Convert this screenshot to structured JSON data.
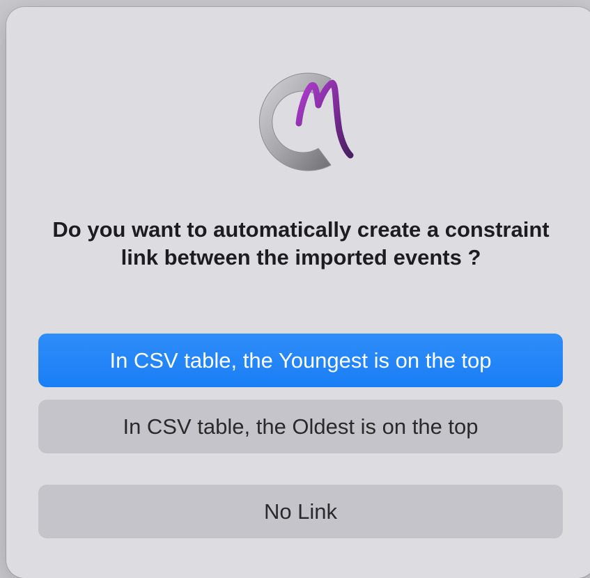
{
  "dialog": {
    "app_icon": "chronomodel-cm-logo-icon",
    "message": "Do you want to automatically create a constraint link between the imported events ?",
    "buttons": {
      "youngest_top": "In CSV table, the Youngest is on the top",
      "oldest_top": "In CSV table, the Oldest is on the top",
      "no_link": "No Link"
    }
  },
  "colors": {
    "dialog_background": "#dddce1",
    "primary_button": "#1a7ef5",
    "secondary_button": "#c5c4ca",
    "logo_gray": "#a9a9ad",
    "logo_purple": "#7b2d9b"
  }
}
